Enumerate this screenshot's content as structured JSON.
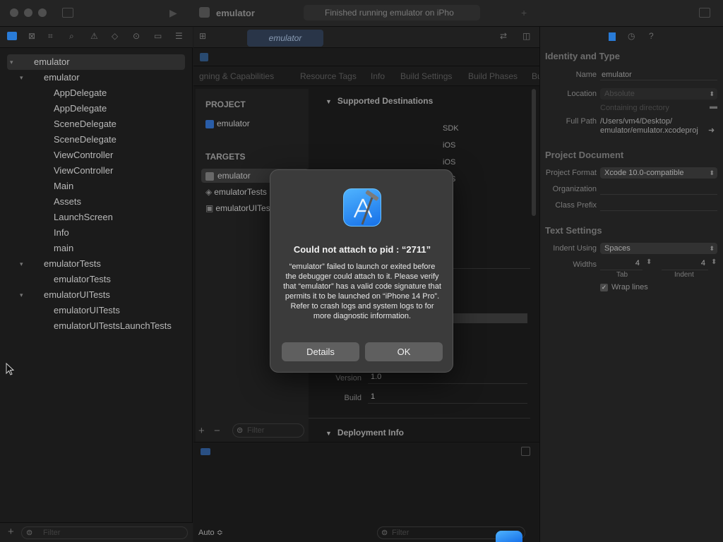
{
  "window": {
    "title": "emulator",
    "status": "Finished running emulator on iPho"
  },
  "editor": {
    "active_tab": "emulator",
    "segments": [
      "gning & Capabilities",
      "Resource Tags",
      "Info",
      "Build Settings",
      "Build Phases",
      "Bu"
    ],
    "project_header": "PROJECT",
    "project_item": "emulator",
    "targets_header": "TARGETS",
    "targets": [
      "emulator",
      "emulatorTests",
      "emulatorUITests"
    ],
    "filter_placeholder": "Filter",
    "supported_destinations": "Supported Destinations",
    "sdk_header": "SDK",
    "sdk_values": [
      "iOS",
      "iOS",
      "iOS"
    ],
    "version_label": "Version",
    "version_value": "1.0",
    "build_label": "Build",
    "build_value": "1",
    "deployment_info": "Deployment Info"
  },
  "navigator": {
    "items": [
      {
        "label": "emulator",
        "level": 0,
        "expanded": true,
        "selected": true
      },
      {
        "label": "emulator",
        "level": 1,
        "expanded": true
      },
      {
        "label": "AppDelegate",
        "level": 2
      },
      {
        "label": "AppDelegate",
        "level": 2
      },
      {
        "label": "SceneDelegate",
        "level": 2
      },
      {
        "label": "SceneDelegate",
        "level": 2
      },
      {
        "label": "ViewController",
        "level": 2
      },
      {
        "label": "ViewController",
        "level": 2
      },
      {
        "label": "Main",
        "level": 2
      },
      {
        "label": "Assets",
        "level": 2
      },
      {
        "label": "LaunchScreen",
        "level": 2
      },
      {
        "label": "Info",
        "level": 2
      },
      {
        "label": "main",
        "level": 2
      },
      {
        "label": "emulatorTests",
        "level": 1,
        "expanded": true
      },
      {
        "label": "emulatorTests",
        "level": 2
      },
      {
        "label": "emulatorUITests",
        "level": 1,
        "expanded": true
      },
      {
        "label": "emulatorUITests",
        "level": 2
      },
      {
        "label": "emulatorUITestsLaunchTests",
        "level": 2
      }
    ],
    "filter_placeholder": "Filter"
  },
  "debug": {
    "scheme_selector": "Auto ≎",
    "filter_placeholder": "Filter"
  },
  "inspector": {
    "identity_header": "Identity and Type",
    "name_label": "Name",
    "name_value": "emulator",
    "location_label": "Location",
    "location_value": "Absolute",
    "containing_dir": "Containing directory",
    "full_path_label": "Full Path",
    "full_path_line1": "/Users/vm4/Desktop/",
    "full_path_line2": "emulator/emulator.xcodeproj",
    "project_doc_header": "Project Document",
    "format_label": "Project Format",
    "format_value": "Xcode 10.0-compatible",
    "org_label": "Organization",
    "prefix_label": "Class Prefix",
    "text_settings_header": "Text Settings",
    "indent_label": "Indent Using",
    "indent_value": "Spaces",
    "widths_label": "Widths",
    "tab_value": "4",
    "indent_width_value": "4",
    "tab_caption": "Tab",
    "indent_caption": "Indent",
    "wrap_label": "Wrap lines"
  },
  "dialog": {
    "title": "Could not attach to pid : “2711”",
    "message": "“emulator” failed to launch or exited before the debugger could attach to it. Please verify that “emulator” has a valid code signature that permits it to be launched on “iPhone 14 Pro”. Refer to crash logs and system logs to for more diagnostic information.",
    "details_button": "Details",
    "ok_button": "OK"
  },
  "colors": {
    "accent": "#2f8cf5",
    "dialog_bg": "#3b3b3b"
  }
}
